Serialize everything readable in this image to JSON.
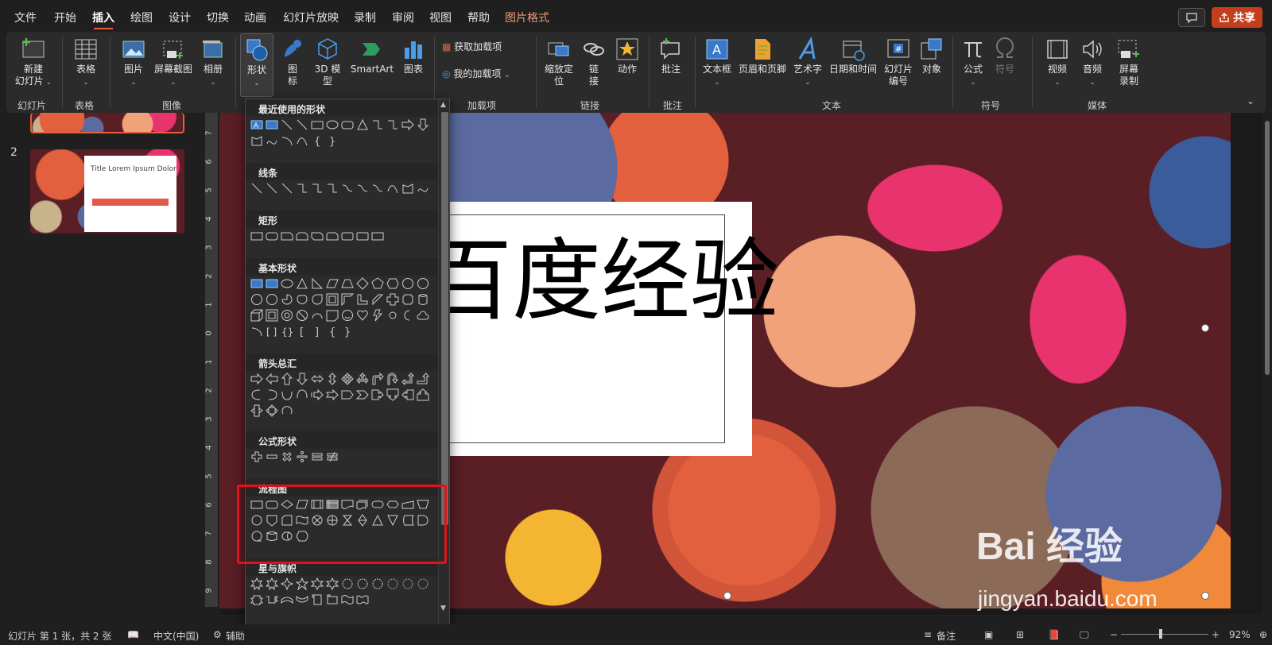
{
  "menu": {
    "items": [
      "文件",
      "开始",
      "插入",
      "绘图",
      "设计",
      "切换",
      "动画",
      "幻灯片放映",
      "录制",
      "审阅",
      "视图",
      "帮助",
      "图片格式"
    ],
    "active": "插入",
    "share_label": "共享"
  },
  "ribbon": {
    "new_slide": "新建\n幻灯片",
    "table": "表格",
    "picture": "图片",
    "screenshot": "屏幕截图",
    "album": "相册",
    "shapes": "形状",
    "icons": "图\n标",
    "model3d": "3D 模\n型",
    "smartart": "SmartArt",
    "chart": "图表",
    "get_addins": "获取加载项",
    "my_addins": "我的加载项",
    "zoom": "缩放定\n位",
    "link": "链\n接",
    "action": "动作",
    "comment": "批注",
    "textbox": "文本框",
    "header_footer": "页眉和页脚",
    "wordart": "艺术字",
    "datetime": "日期和时间",
    "slide_number": "幻灯片\n编号",
    "object": "对象",
    "equation": "公式",
    "symbol": "符号",
    "video": "视频",
    "audio": "音频",
    "screen_record": "屏幕\n录制",
    "groups": {
      "slides": "幻灯片",
      "tables": "表格",
      "images": "图像",
      "addins": "加载项",
      "links": "链接",
      "comments": "批注",
      "text": "文本",
      "symbols": "符号",
      "media": "媒体"
    }
  },
  "thumbnails": {
    "slide2_number": "2",
    "slide2_title": "Title Lorem Ipsum Dolor"
  },
  "ruler_numbers": [
    "7",
    "6",
    "5",
    "4",
    "3",
    "2",
    "1",
    "0",
    "1",
    "2",
    "3",
    "4",
    "5",
    "6",
    "7",
    "8",
    "9"
  ],
  "slide": {
    "title": "百度经验"
  },
  "shapes_panel": {
    "categories": [
      "最近使用的形状",
      "线条",
      "矩形",
      "基本形状",
      "箭头总汇",
      "公式形状",
      "流程图",
      "星与旗帜"
    ]
  },
  "watermark": {
    "logo": "Bai 经验",
    "url": "jingyan.baidu.com"
  },
  "status": {
    "slide_info": "幻灯片 第 1 张，共 2 张",
    "language": "中文(中国)",
    "accessibility": "辅助",
    "notes": "备注",
    "zoom_level": "92%"
  },
  "colors": {
    "accent": "#e2603d",
    "share": "#c43e1c",
    "highlight": "#e0131b",
    "slide_bg": "#5a1e25"
  }
}
